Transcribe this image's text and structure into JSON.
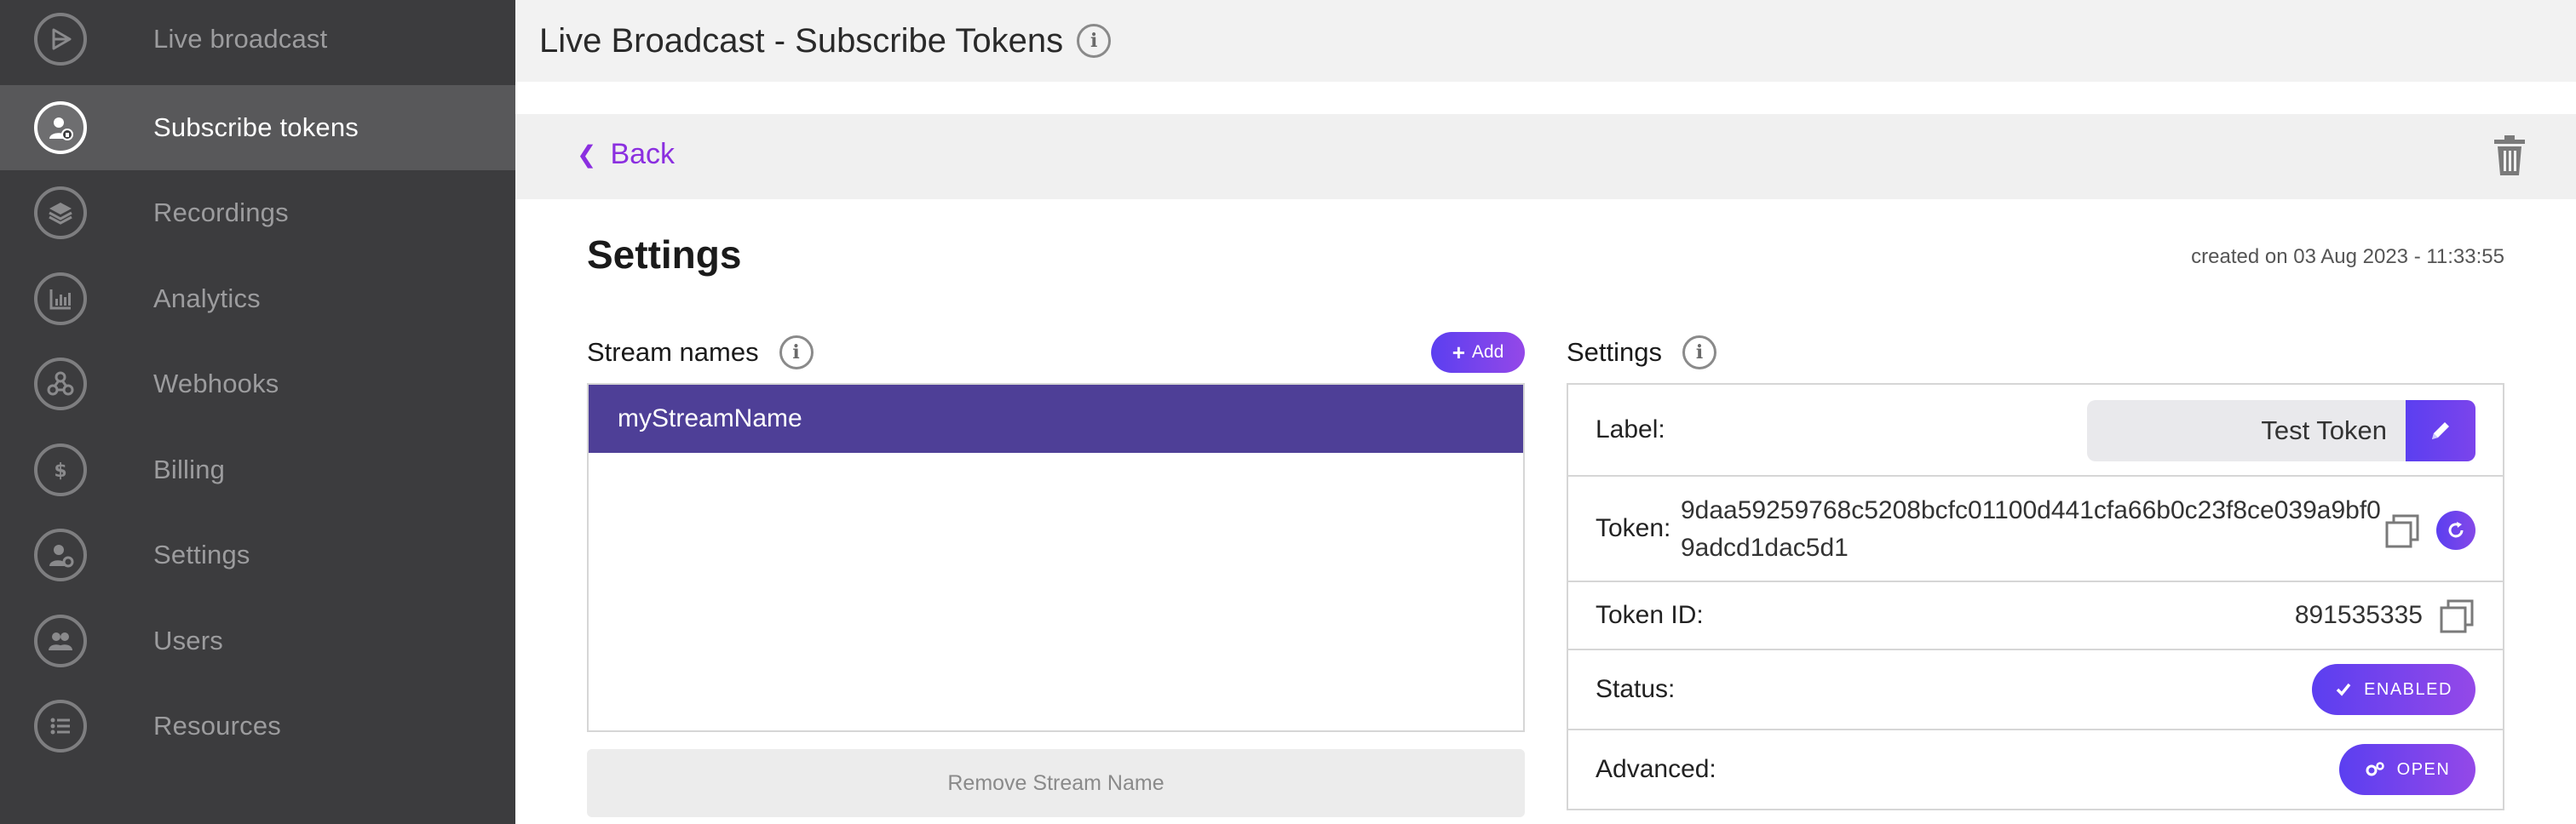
{
  "sidebar": {
    "items": [
      {
        "label": "Live broadcast",
        "icon": "broadcast-icon"
      },
      {
        "label": "Subscribe tokens",
        "icon": "user-lock-icon",
        "active": true
      },
      {
        "label": "Recordings",
        "icon": "layers-icon"
      },
      {
        "label": "Analytics",
        "icon": "bar-chart-icon"
      },
      {
        "label": "Webhooks",
        "icon": "webhook-icon"
      },
      {
        "label": "Billing",
        "icon": "dollar-icon"
      },
      {
        "label": "Settings",
        "icon": "user-gear-icon"
      },
      {
        "label": "Users",
        "icon": "users-icon"
      },
      {
        "label": "Resources",
        "icon": "list-icon"
      }
    ]
  },
  "header": {
    "title": "Live Broadcast - Subscribe Tokens",
    "info_glyph": "i"
  },
  "backbar": {
    "back_label": "Back"
  },
  "content": {
    "title": "Settings",
    "created_on": "created on 03 Aug 2023 - 11:33:55"
  },
  "stream_names": {
    "heading": "Stream names",
    "add_label": "Add",
    "items": [
      "myStreamName"
    ],
    "remove_label": "Remove Stream Name"
  },
  "settings_panel": {
    "heading": "Settings",
    "label_label": "Label:",
    "label_value": "Test Token",
    "token_label": "Token:",
    "token_value": "9daa59259768c5208bcfc01100d441cfa66b0c23f8ce039a9bf09adcd1dac5d1",
    "token_id_label": "Token ID:",
    "token_id_value": "891535335",
    "status_label": "Status:",
    "status_value": "ENABLED",
    "advanced_label": "Advanced:",
    "advanced_value": "OPEN"
  },
  "colors": {
    "accent_purple": "#8b2fe0",
    "button_gradient_start": "#5b3ff0",
    "button_gradient_end": "#9448e8",
    "selected_row": "#4e3f97",
    "sidebar_bg": "#3c3c3e"
  }
}
